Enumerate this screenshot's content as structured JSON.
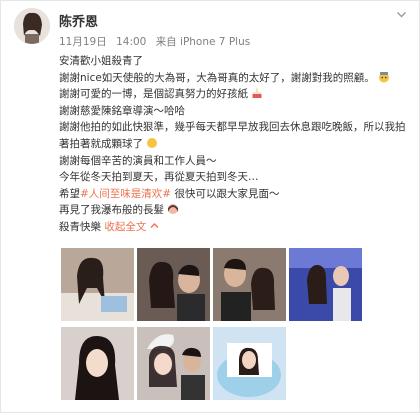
{
  "post": {
    "author": "陈乔恩",
    "date": "11月19日",
    "time": "14:00",
    "source": "来自 iPhone 7 Plus",
    "lines": [
      "安清歡小姐殺青了",
      "謝謝nice如天使般的大為哥，大為哥真的太好了，謝謝對我的照顧。",
      "謝謝可愛的一博，是個認真努力的好孩紙",
      "謝謝慈愛陳銘章導演～哈哈",
      "謝謝他拍的如此快狠準，幾乎每天都早早放我回去休息跟吃晚飯，所以我拍著拍著就成顆球了",
      "謝謝每個辛苦的演員和工作人員～",
      "今年從冬天拍到夏天，再從夏天拍到冬天…"
    ],
    "hope_prefix": "希望",
    "hashtag": "#人间至味是清欢#",
    "hope_suffix": " 很快可以跟大家見面～",
    "hair_line": "再見了我瀑布般的長髮",
    "footer_prefix": "殺青快樂",
    "expand_label": "收起全文"
  },
  "icons": {
    "chevron": "chevron-down-icon",
    "emoji_sweat": "emoji-embarrassed-icon",
    "emoji_cake": "emoji-cake-icon",
    "emoji_face": "emoji-face-icon",
    "expand_arrow": "chevron-up-icon"
  },
  "colors": {
    "link": "#eb7350",
    "meta": "#808080",
    "text": "#333333"
  }
}
